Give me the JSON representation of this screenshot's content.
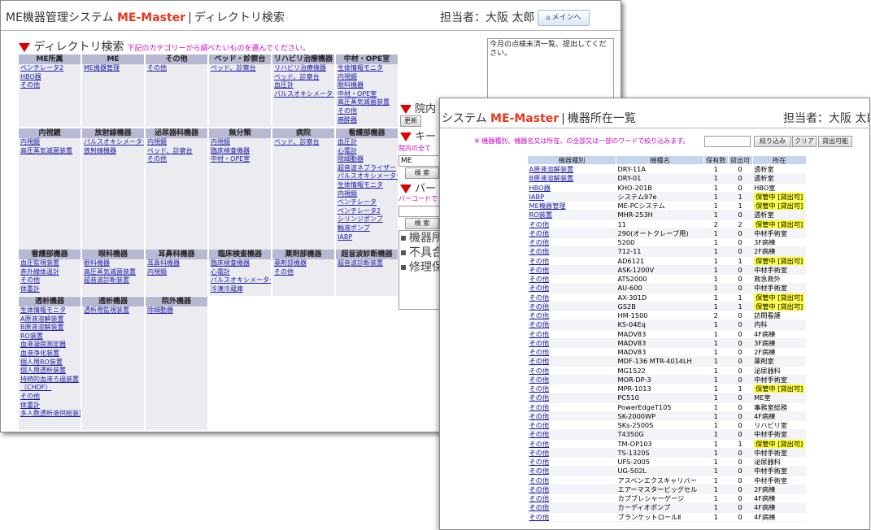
{
  "window1": {
    "app_prefix": "ME機器管理システム",
    "product": "ME-Master",
    "page": "ディレクトリ検索",
    "user": "担当者：大阪 太郎",
    "menu_button": "メインへ",
    "section_title": "ディレクトリ検索",
    "section_sub": "下記のカテゴリーから調べたいものを選んでください。",
    "notice": "今月の点検未済一覧、提出してください。",
    "categories": [
      {
        "title": "ME所属",
        "items": [
          "ベンチレータ2",
          "HBO器",
          "その他"
        ]
      },
      {
        "title": "ME",
        "items": [
          "ME機器管理"
        ]
      },
      {
        "title": "その他",
        "items": [
          "その他"
        ]
      },
      {
        "title": "ベッド・診察台",
        "items": [
          "ベッド、診察台"
        ]
      },
      {
        "title": "リハビリ治療機器",
        "items": [
          "リハビリ治療機器",
          "ベッド、診察台",
          "血圧計",
          "パルスオキシメーター"
        ]
      },
      {
        "title": "中材・OPE室",
        "items": [
          "生体情報モニタ",
          "内視鏡",
          "眼科機器",
          "中材・OPE室",
          "高圧蒸気滅菌装置",
          "その他",
          "麻酔器"
        ]
      },
      {
        "title": "内視鏡",
        "items": [
          "内視鏡",
          "高圧蒸気滅菌装置"
        ]
      },
      {
        "title": "放射線機器",
        "items": [
          "パルスオキシメーター",
          "放射線機器"
        ]
      },
      {
        "title": "泌尿器科機器",
        "items": [
          "内視鏡",
          "ベッド、診察台",
          "その他"
        ]
      },
      {
        "title": "無分類",
        "items": [
          "内視鏡",
          "臨床検査機器",
          "中材・OPE室"
        ]
      },
      {
        "title": "病院",
        "items": [
          "ベッド、診察台"
        ]
      },
      {
        "title": "看護部機器",
        "items": [
          "血圧計",
          "心電計",
          "除細動器",
          "超音波ネブライザー",
          "パルスオキシメーター",
          "生体情報モニタ",
          "内視鏡",
          "ベンチレータ",
          "ベンチレータ2",
          "シリンジポンプ",
          "輸液ポンプ",
          "IABP"
        ]
      },
      {
        "title": "看護部機器",
        "items": [
          "血圧監視装置",
          "赤外線体温計",
          "その他",
          "体重計"
        ]
      },
      {
        "title": "眼科機器",
        "items": [
          "眼科機器",
          "高圧蒸気滅菌装置",
          "超音波診断装置"
        ]
      },
      {
        "title": "耳鼻科機器",
        "items": [
          "耳鼻科機器",
          "内視鏡"
        ]
      },
      {
        "title": "臨床検査機器",
        "items": [
          "臨床検査機器",
          "心電計",
          "パルスオキシメーター",
          "冷凍冷蔵庫"
        ]
      },
      {
        "title": "薬剤部機器",
        "items": [
          "薬剤部機器",
          "その他"
        ]
      },
      {
        "title": "超音波診断機器",
        "items": [
          "超音波診断装置"
        ]
      },
      {
        "title": "透析機器",
        "items": [
          "生体情報モニタ",
          "A原液溶解装置",
          "B原液溶解装置",
          "RO装置",
          "血液凝固測定器",
          "血液浄化装置",
          "個人用RO装置",
          "個人用透析装置",
          "持続的血液ろ過装置",
          "（CHDF）",
          "その他",
          "体重計",
          "多人数透析液供給装置"
        ]
      },
      {
        "title": "透析機器",
        "items": [
          "透析用監視装置"
        ]
      },
      {
        "title": "院外機器",
        "items": [
          "除細動器"
        ]
      }
    ],
    "side": {
      "heading1": "院内",
      "update_button": "更新",
      "heading2": "キー",
      "subtitle1": "院内の全て",
      "input_value": "ME",
      "search_button": "検 索",
      "heading3": "バー",
      "subtitle2": "バーコードで",
      "search_button2": "検 索",
      "box_items": [
        "機器所",
        "不具合",
        "修理保"
      ]
    }
  },
  "window2": {
    "app_suffix": "システム",
    "product": "ME-Master",
    "page": "機器所在一覧",
    "user": "担当者：大阪 太郎",
    "filter_text": "※ 機器種別、機器名又は所在、の全部又は一部のワードで絞り込みます。",
    "buttons": {
      "filter": "絞り込み",
      "clear": "クリア",
      "available": "貸出可能"
    },
    "columns": [
      "機器種別",
      "機種名",
      "保有数",
      "貸出可",
      "所在"
    ],
    "rows": [
      [
        "A原液溶解装置",
        "DRY-11A",
        "1",
        "0",
        "透析室"
      ],
      [
        "B原液溶解装置",
        "DRY-01",
        "1",
        "0",
        "透析室"
      ],
      [
        "HBO器",
        "KHO-201B",
        "1",
        "0",
        "HBO室"
      ],
      [
        "IABP",
        "システム97e",
        "1",
        "1",
        "保管中 [貸出可]"
      ],
      [
        "ME機器管理",
        "ME-PCシステム",
        "1",
        "1",
        "保管中 [貸出可]"
      ],
      [
        "RO装置",
        "MHR-253H",
        "1",
        "0",
        "透析室"
      ],
      [
        "その他",
        "11",
        "2",
        "2",
        "保管中 [貸出可]"
      ],
      [
        "その他",
        "290(オートクレーブ用)",
        "1",
        "0",
        "中材手術室"
      ],
      [
        "その他",
        "5200",
        "1",
        "0",
        "3F病棟"
      ],
      [
        "その他",
        "712-11",
        "1",
        "0",
        "2F病棟"
      ],
      [
        "その他",
        "AD6121",
        "1",
        "1",
        "保管中 [貸出可]"
      ],
      [
        "その他",
        "ASK-1200V",
        "1",
        "0",
        "中材手術室"
      ],
      [
        "その他",
        "ATS2000",
        "1",
        "0",
        "救急救外"
      ],
      [
        "その他",
        "AU-600",
        "1",
        "0",
        "中材手術室"
      ],
      [
        "その他",
        "AX-301D",
        "1",
        "1",
        "保管中 [貸出可]"
      ],
      [
        "その他",
        "GS2B",
        "1",
        "1",
        "保管中 [貸出可]"
      ],
      [
        "その他",
        "HM-1500",
        "2",
        "0",
        "訪問看護"
      ],
      [
        "その他",
        "KS-04Eq",
        "1",
        "0",
        "内科"
      ],
      [
        "その他",
        "MADV83",
        "1",
        "0",
        "4F病棟"
      ],
      [
        "その他",
        "MADV83",
        "1",
        "0",
        "3F病棟"
      ],
      [
        "その他",
        "MADV83",
        "1",
        "0",
        "2F病棟"
      ],
      [
        "その他",
        "MDF-136 MTR-4014LH",
        "1",
        "0",
        "薬剤室"
      ],
      [
        "その他",
        "MG1522",
        "1",
        "0",
        "泌尿器科"
      ],
      [
        "その他",
        "MOR-DP-3",
        "1",
        "0",
        "中材手術室"
      ],
      [
        "その他",
        "MPR-1013",
        "1",
        "1",
        "保管中 [貸出可]"
      ],
      [
        "その他",
        "PC510",
        "1",
        "0",
        "ME室"
      ],
      [
        "その他",
        "PowerEdgeT105",
        "1",
        "0",
        "事務室総務"
      ],
      [
        "その他",
        "SK-2000WP",
        "1",
        "0",
        "4F病棟"
      ],
      [
        "その他",
        "SKs-2500S",
        "1",
        "0",
        "リハビリ室"
      ],
      [
        "その他",
        "T4350G",
        "1",
        "0",
        "中材手術室"
      ],
      [
        "その他",
        "TM-OP103",
        "1",
        "1",
        "保管中 [貸出可]"
      ],
      [
        "その他",
        "TS-1320S",
        "1",
        "0",
        "中材手術室"
      ],
      [
        "その他",
        "UFS-2005",
        "1",
        "0",
        "泌尿器科"
      ],
      [
        "その他",
        "UG-502L",
        "1",
        "0",
        "中材手術室"
      ],
      [
        "その他",
        "アスペンエクスキャリバー",
        "1",
        "0",
        "中材手術室"
      ],
      [
        "その他",
        "エアーマスタービッグセル",
        "1",
        "0",
        "2F病棟"
      ],
      [
        "その他",
        "カプブレシャーゲージ",
        "1",
        "0",
        "4F病棟"
      ],
      [
        "その他",
        "カーディオポンプ",
        "1",
        "0",
        "4F病棟"
      ],
      [
        "その他",
        "ブランケットロールⅡ",
        "1",
        "0",
        "4F病棟"
      ]
    ]
  }
}
